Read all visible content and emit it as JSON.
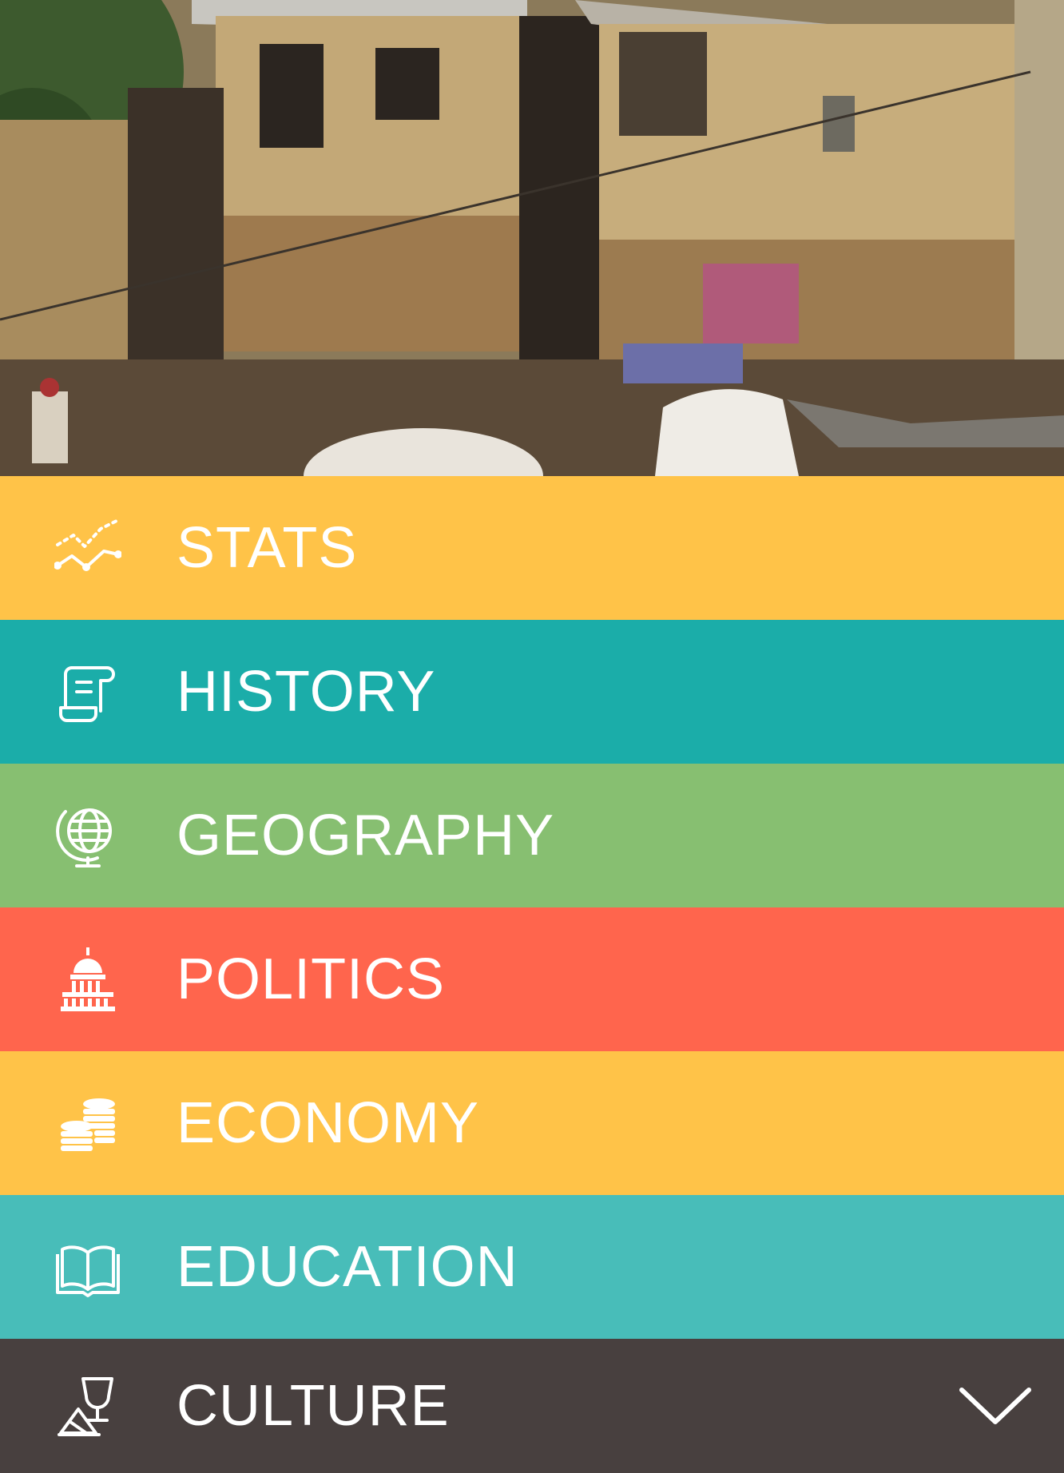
{
  "hero": {
    "image": "street-scene-with-brick-houses"
  },
  "menu": {
    "items": [
      {
        "label": "STATS",
        "icon": "trend-line-icon",
        "color": "#FFC348"
      },
      {
        "label": "HISTORY",
        "icon": "scroll-icon",
        "color": "#1BADA9"
      },
      {
        "label": "GEOGRAPHY",
        "icon": "globe-icon",
        "color": "#87BF71"
      },
      {
        "label": "POLITICS",
        "icon": "capitol-icon",
        "color": "#FF654D"
      },
      {
        "label": "ECONOMY",
        "icon": "coins-icon",
        "color": "#FFC348"
      },
      {
        "label": "EDUCATION",
        "icon": "open-book-icon",
        "color": "#48BDB9"
      },
      {
        "label": "CULTURE",
        "icon": "goblet-icon",
        "color": "#48403F",
        "expand_icon": "chevron-down-icon"
      }
    ]
  }
}
